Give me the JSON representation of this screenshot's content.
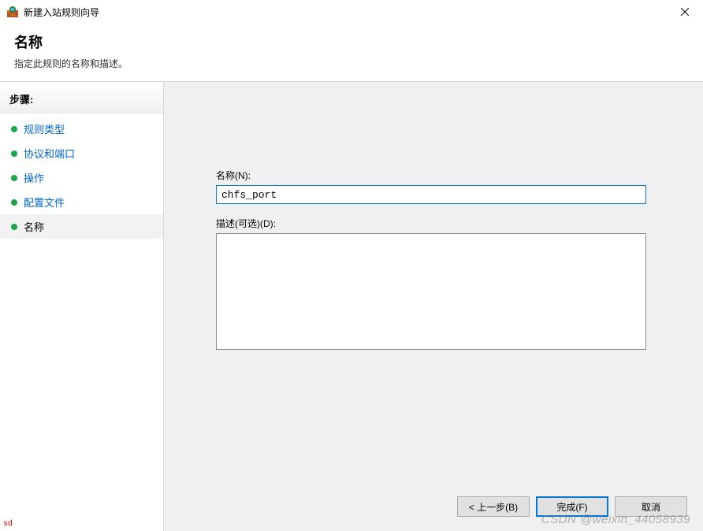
{
  "window": {
    "title": "新建入站规则向导"
  },
  "header": {
    "title": "名称",
    "subtitle": "指定此规则的名称和描述。"
  },
  "sidebar": {
    "steps_label": "步骤:",
    "items": [
      {
        "label": "规则类型",
        "state": "link"
      },
      {
        "label": "协议和端口",
        "state": "link"
      },
      {
        "label": "操作",
        "state": "link"
      },
      {
        "label": "配置文件",
        "state": "link"
      },
      {
        "label": "名称",
        "state": "current"
      }
    ]
  },
  "form": {
    "name_label": "名称(N):",
    "name_hotkey": "N",
    "name_value": "chfs_port",
    "desc_label": "描述(可选)(D):",
    "desc_hotkey": "D",
    "desc_value": ""
  },
  "buttons": {
    "back": "< 上一步(B)",
    "finish": "完成(F)",
    "cancel": "取消"
  },
  "watermark": "CSDN @weixin_44058939",
  "corner": "sd"
}
